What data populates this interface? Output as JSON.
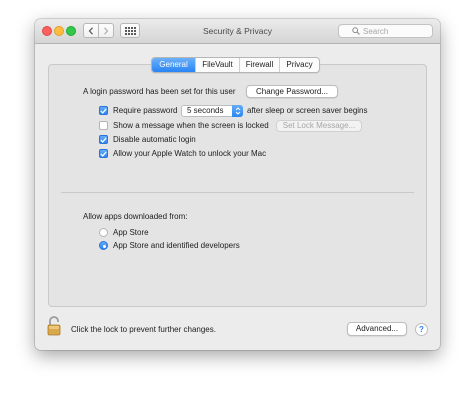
{
  "window": {
    "title": "Security & Privacy"
  },
  "toolbar": {
    "search_placeholder": "Search"
  },
  "icons": {
    "back": "chevron-left-icon",
    "forward": "chevron-right-icon",
    "show_all": "grid-icon",
    "search": "search-icon",
    "lock": "lock-icon",
    "help": "help-icon"
  },
  "tabs": [
    {
      "label": "General",
      "active": true
    },
    {
      "label": "FileVault",
      "active": false
    },
    {
      "label": "Firewall",
      "active": false
    },
    {
      "label": "Privacy",
      "active": false
    }
  ],
  "general": {
    "password_set_text": "A login password has been set for this user",
    "change_password_button": "Change Password...",
    "require_password": {
      "label": "Require password",
      "checked": true
    },
    "require_password_select": {
      "value": "5 seconds"
    },
    "require_password_suffix": "after sleep or screen saver begins",
    "show_message": {
      "label": "Show a message when the screen is locked",
      "checked": false
    },
    "set_lock_message_button": "Set Lock Message...",
    "disable_auto_login": {
      "label": "Disable automatic login",
      "checked": true
    },
    "apple_watch": {
      "label": "Allow your Apple Watch to unlock your Mac",
      "checked": true
    },
    "allow_apps_label": "Allow apps downloaded from:",
    "allow_apps_options": [
      {
        "label": "App Store",
        "selected": false
      },
      {
        "label": "App Store and identified developers",
        "selected": true
      }
    ]
  },
  "footer": {
    "lock_text": "Click the lock to prevent further changes.",
    "advanced_button": "Advanced...",
    "help_glyph": "?"
  },
  "colors": {
    "accent": "#2c86f4",
    "close": "#fc605c",
    "minimize": "#fdbc40",
    "zoom": "#34c84a",
    "lock_body": "#d9a84a"
  }
}
